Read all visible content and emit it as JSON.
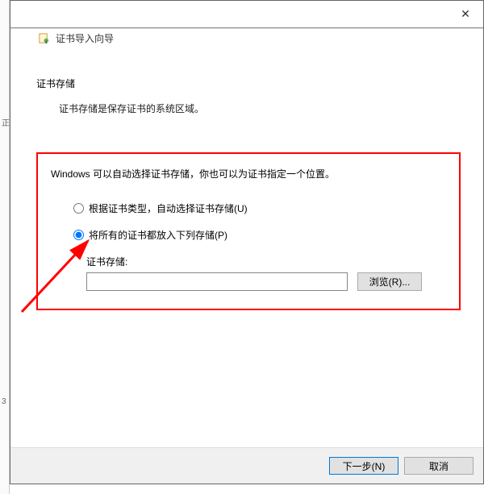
{
  "window": {
    "close_glyph": "✕"
  },
  "header": {
    "title": "证书导入向导",
    "icon_name": "certificate-icon"
  },
  "body": {
    "section_heading": "证书存储",
    "section_desc": "证书存储是保存证书的系统区域。",
    "instruction": "Windows 可以自动选择证书存储，你也可以为证书指定一个位置。",
    "radio_auto": "根据证书类型，自动选择证书存储(U)",
    "radio_place": "将所有的证书都放入下列存储(P)",
    "selected": "place",
    "store_label": "证书存储:",
    "store_value": "",
    "browse": "浏览(R)..."
  },
  "footer": {
    "next": "下一步(N)",
    "cancel": "取消"
  },
  "ruler": {
    "a": "正",
    "b": "3"
  }
}
